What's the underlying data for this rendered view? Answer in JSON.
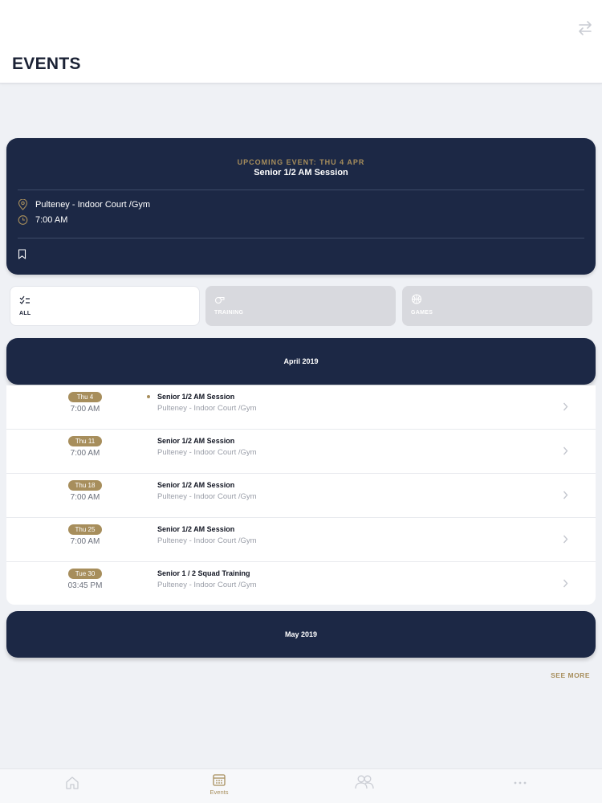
{
  "header": {
    "title": "EVENTS"
  },
  "upcoming": {
    "label": "UPCOMING EVENT: THU 4 APR",
    "title": "Senior 1/2 AM Session",
    "location": "Pulteney - Indoor Court /Gym",
    "time": "7:00 AM"
  },
  "filters": [
    {
      "label": "ALL",
      "icon": "checklist-icon",
      "active": true
    },
    {
      "label": "TRAINING",
      "icon": "whistle-icon",
      "active": false
    },
    {
      "label": "GAMES",
      "icon": "ball-icon",
      "active": false
    }
  ],
  "months": {
    "april": "April 2019",
    "may": "May 2019"
  },
  "events": [
    {
      "date": "Thu 4",
      "time": "7:00 AM",
      "title": "Senior 1/2 AM Session",
      "location": "Pulteney - Indoor Court /Gym"
    },
    {
      "date": "Thu 11",
      "time": "7:00 AM",
      "title": "Senior 1/2 AM Session",
      "location": "Pulteney - Indoor Court /Gym"
    },
    {
      "date": "Thu 18",
      "time": "7:00 AM",
      "title": "Senior 1/2 AM Session",
      "location": "Pulteney - Indoor Court /Gym"
    },
    {
      "date": "Thu 25",
      "time": "7:00 AM",
      "title": "Senior 1/2 AM Session",
      "location": "Pulteney - Indoor Court /Gym"
    },
    {
      "date": "Tue 30",
      "time": "03:45 PM",
      "title": "Senior 1 / 2 Squad Training",
      "location": "Pulteney - Indoor Court /Gym"
    }
  ],
  "see_more": "SEE MORE",
  "tabbar": {
    "events_label": "Events"
  },
  "colors": {
    "navy": "#1c2845",
    "gold": "#a78e5c",
    "background": "#eff1f5"
  }
}
